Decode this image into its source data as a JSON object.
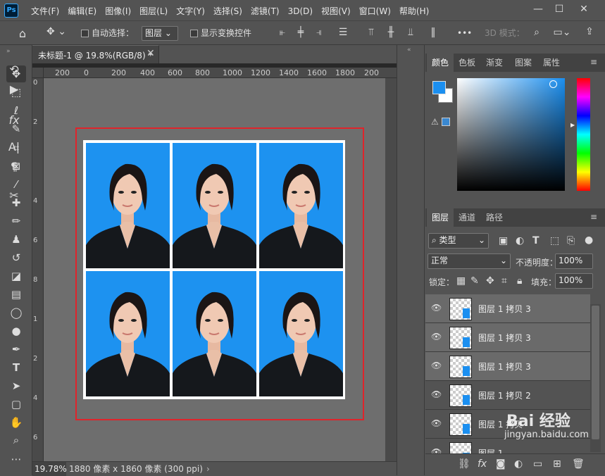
{
  "app": {
    "logo": "Ps"
  },
  "menu": [
    "文件(F)",
    "编辑(E)",
    "图像(I)",
    "图层(L)",
    "文字(Y)",
    "选择(S)",
    "滤镜(T)",
    "3D(D)",
    "视图(V)",
    "窗口(W)",
    "帮助(H)"
  ],
  "window_controls": {
    "minimize": "—",
    "restore": "☐",
    "close": "✕"
  },
  "options": {
    "auto_select_label": "自动选择：",
    "auto_select_target": "图层",
    "show_transform_label": "显示变换控件",
    "mode_3d": "3D 模式：",
    "more": "•••"
  },
  "document": {
    "tab_title": "未标题-1 @ 19.8%(RGB/8) *",
    "zoom": "19.78%",
    "info": "1880 像素 x 1860 像素 (300 ppi)",
    "ruler_h": [
      "200",
      "0",
      "200",
      "400",
      "600",
      "800",
      "1000",
      "1200",
      "1400",
      "1600",
      "1800",
      "200"
    ],
    "ruler_v": [
      "0",
      "2",
      "4",
      "6",
      "8",
      "1",
      "2",
      "4",
      "6"
    ],
    "photo_grid": {
      "rows": 2,
      "cols": 3
    }
  },
  "color_panel": {
    "tabs": [
      "颜色",
      "色板",
      "渐变",
      "图案",
      "属性"
    ],
    "foreground": "#1b8ff0",
    "background": "#ffffff"
  },
  "layers_panel": {
    "tabs": [
      "图层",
      "通道",
      "路径"
    ],
    "filter_kind": "类型",
    "blend_mode": "正常",
    "opacity_label": "不透明度：",
    "opacity": "100%",
    "lock_label": "锁定：",
    "fill_label": "填充：",
    "fill": "100%",
    "layers": [
      {
        "name": "图层 1 拷贝 3",
        "selected": true
      },
      {
        "name": "图层 1 拷贝 3",
        "selected": true
      },
      {
        "name": "图层 1 拷贝 3",
        "selected": true
      },
      {
        "name": "图层 1 拷贝 2",
        "selected": false
      },
      {
        "name": "图层 1 拷贝",
        "selected": false
      },
      {
        "name": "图层 1",
        "selected": false
      }
    ]
  },
  "watermark": {
    "brand": "Bai 经验",
    "url": "jingyan.baidu.com"
  }
}
